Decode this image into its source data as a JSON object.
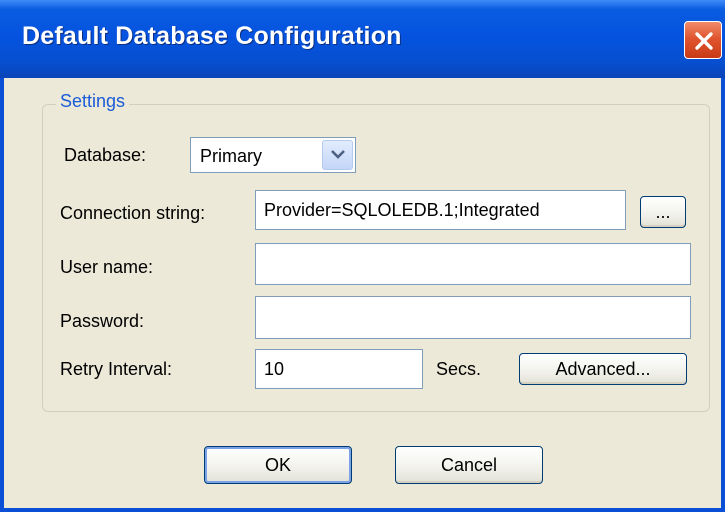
{
  "window": {
    "title": "Default Database Configuration"
  },
  "group": {
    "legend": "Settings"
  },
  "fields": {
    "database_label": "Database:",
    "database_value": "Primary",
    "connection_label": "Connection string:",
    "connection_value": "Provider=SQLOLEDB.1;Integrated",
    "browse_label": "...",
    "username_label": "User name:",
    "username_value": "",
    "password_label": "Password:",
    "password_value": "",
    "retry_label": "Retry Interval:",
    "retry_value": "10",
    "retry_unit": "Secs.",
    "advanced_label": "Advanced..."
  },
  "buttons": {
    "ok_label": "OK",
    "cancel_label": "Cancel"
  },
  "icons": {
    "close": "close-icon",
    "dropdown": "chevron-down-icon"
  },
  "colors": {
    "titlebar": "#0553e0",
    "close_button": "#e0552f",
    "legend_text": "#1a5bd8",
    "dialog_background": "#ece9d8"
  }
}
